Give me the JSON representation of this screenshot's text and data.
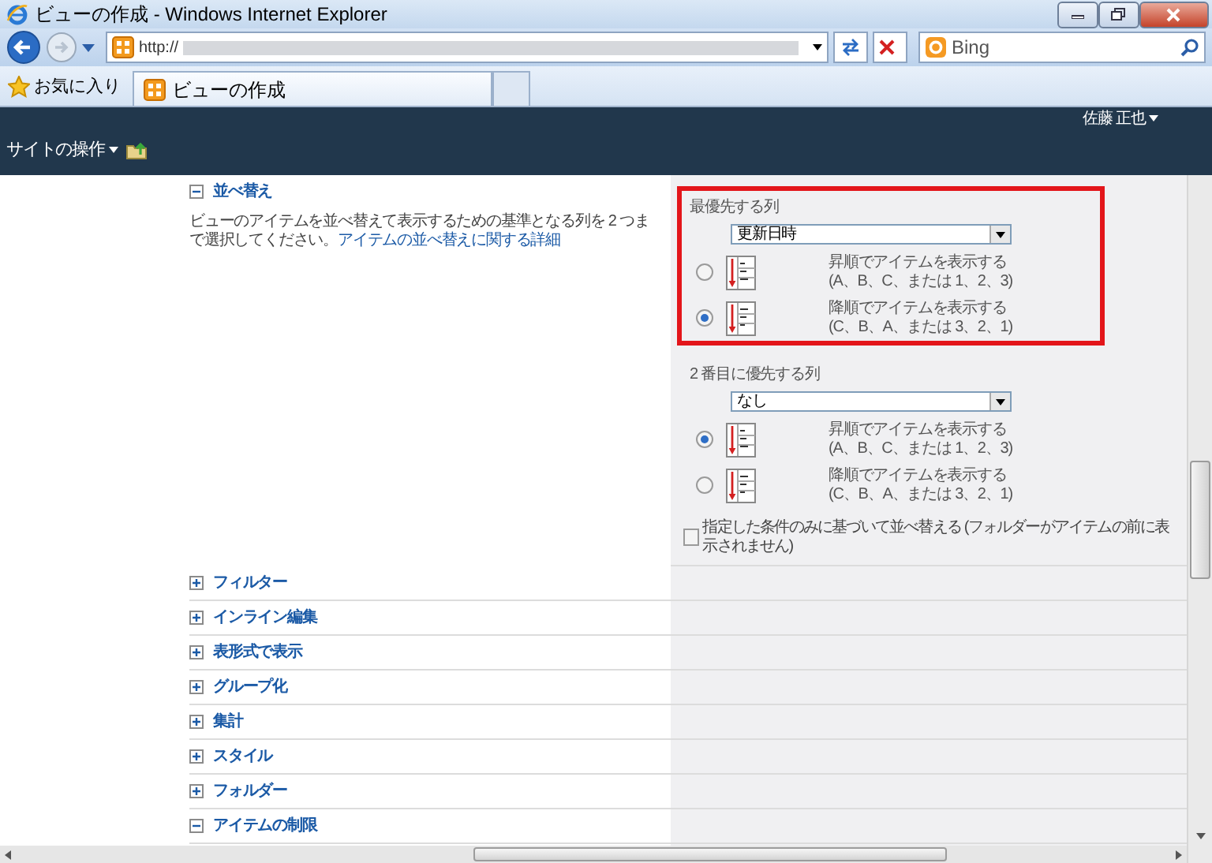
{
  "window": {
    "title": "ビューの作成 - Windows Internet Explorer"
  },
  "address_bar": {
    "url": "http://"
  },
  "search_box": {
    "provider": "Bing"
  },
  "favorites": {
    "label": "お気に入り"
  },
  "tabs": [
    {
      "label": "ビューの作成",
      "selected": true
    }
  ],
  "site_bar": {
    "site_actions": "サイトの操作",
    "user": "佐藤 正也"
  },
  "sort_section": {
    "title": "並べ替え",
    "expanded": true,
    "description": "ビューのアイテムを並べ替えて表示するための基準となる列を 2 つまで選択してください。",
    "link": "アイテムの並べ替えに関する詳細",
    "sort_keys": [
      {
        "label": "最優先する列",
        "value": "更新日時",
        "highlighted": true,
        "options": [
          {
            "kind": "ascending",
            "title": "昇順でアイテムを表示する",
            "example": "(A、B、C、または 1、2、3)",
            "selected": false
          },
          {
            "kind": "descending",
            "title": "降順でアイテムを表示する",
            "example": "(C、B、A、または 3、2、1)",
            "selected": true
          }
        ]
      },
      {
        "label": "2 番目に優先する列",
        "value": "なし",
        "highlighted": false,
        "options": [
          {
            "kind": "ascending",
            "title": "昇順でアイテムを表示する",
            "example": "(A、B、C、または 1、2、3)",
            "selected": true
          },
          {
            "kind": "descending",
            "title": "降順でアイテムを表示する",
            "example": "(C、B、A、または 3、2、1)",
            "selected": false
          }
        ]
      }
    ],
    "checkbox": {
      "label": "指定した条件のみに基づいて並べ替える (フォルダーがアイテムの前に表示されません)",
      "checked": false
    }
  },
  "sections": [
    {
      "title": "フィルター",
      "expanded": false
    },
    {
      "title": "インライン編集",
      "expanded": false
    },
    {
      "title": "表形式で表示",
      "expanded": false
    },
    {
      "title": "グループ化",
      "expanded": false
    },
    {
      "title": "集計",
      "expanded": false
    },
    {
      "title": "スタイル",
      "expanded": false
    },
    {
      "title": "フォルダー",
      "expanded": false
    },
    {
      "title": "アイテムの制限",
      "expanded": true
    }
  ]
}
